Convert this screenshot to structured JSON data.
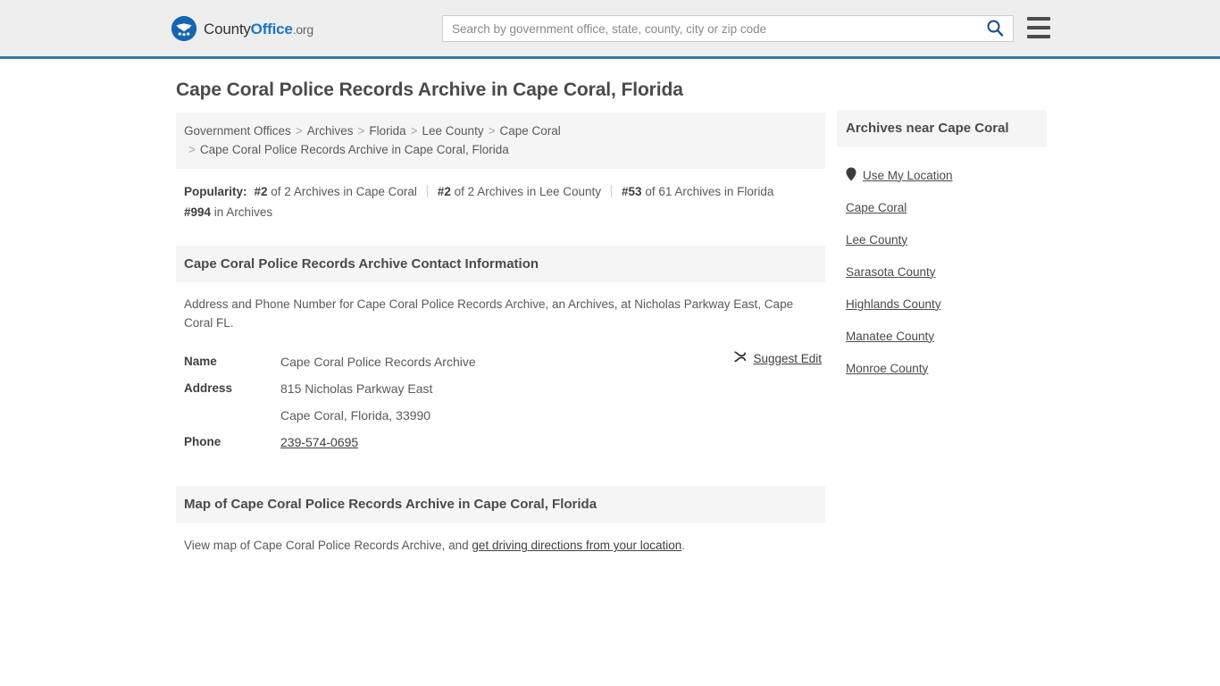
{
  "header": {
    "brand": {
      "county": "County",
      "office": "Office",
      "org": ".org",
      "logo_icon": "eagle-stars-seal-icon"
    },
    "search": {
      "placeholder": "Search by government office, state, county, city or zip code",
      "value": "",
      "button_icon": "search-icon"
    },
    "menu_icon": "hamburger-menu-icon",
    "accent_color": "#3b77ab",
    "background_color": "#eeeeee"
  },
  "main": {
    "title": "Cape Coral Police Records Archive in Cape Coral, Florida",
    "breadcrumb": {
      "separator": ">",
      "items": [
        {
          "label": "Government Offices",
          "link": true
        },
        {
          "label": "Archives",
          "link": true
        },
        {
          "label": "Florida",
          "link": true
        },
        {
          "label": "Lee County",
          "link": true
        },
        {
          "label": "Cape Coral",
          "link": true
        },
        {
          "label": "Cape Coral Police Records Archive in Cape Coral, Florida",
          "link": false
        }
      ]
    },
    "popularity": {
      "label": "Popularity:",
      "items": [
        {
          "rank": "#2",
          "text": " of 2 Archives in Cape Coral"
        },
        {
          "rank": "#2",
          "text": " of 2 Archives in Lee County"
        },
        {
          "rank": "#53",
          "text": " of 61 Archives in Florida"
        },
        {
          "rank": "#994",
          "text": " in Archives"
        }
      ]
    },
    "contact": {
      "heading": "Cape Coral Police Records Archive Contact Information",
      "description": "Address and Phone Number for Cape Coral Police Records Archive, an Archives, at Nicholas Parkway East, Cape Coral FL.",
      "suggest_edit": {
        "label": "Suggest Edit",
        "icon": "pencil-edit-icon"
      },
      "rows": [
        {
          "label": "Name",
          "value": "Cape Coral Police Records Archive"
        },
        {
          "label": "Address",
          "value": "815 Nicholas Parkway East"
        },
        {
          "label": "",
          "value": "Cape Coral, Florida, 33990"
        },
        {
          "label": "Phone",
          "value": "239-574-0695",
          "is_link": true
        }
      ]
    },
    "map": {
      "heading": "Map of Cape Coral Police Records Archive in Cape Coral, Florida",
      "desc_prefix": "View map of Cape Coral Police Records Archive, and ",
      "desc_link": "get driving directions from your location",
      "desc_suffix": "."
    }
  },
  "sidebar": {
    "heading": "Archives near Cape Coral",
    "items": [
      {
        "label": "Use My Location",
        "icon": "map-pin-icon"
      },
      {
        "label": "Cape Coral",
        "icon": ""
      },
      {
        "label": "Lee County",
        "icon": ""
      },
      {
        "label": "Sarasota County",
        "icon": ""
      },
      {
        "label": "Highlands County",
        "icon": ""
      },
      {
        "label": "Manatee County",
        "icon": ""
      },
      {
        "label": "Monroe County",
        "icon": ""
      }
    ]
  }
}
